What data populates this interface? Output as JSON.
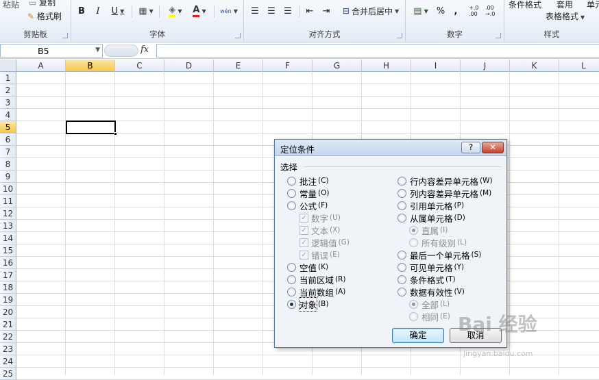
{
  "ribbon": {
    "clipboard": {
      "paste_label": "粘贴",
      "copy_label": "复制",
      "format_painter_label": "格式刷",
      "group_label": "剪贴板"
    },
    "font": {
      "bold": "B",
      "italic": "I",
      "underline": "U",
      "font_color": "A",
      "phonetic": "wén",
      "group_label": "字体"
    },
    "alignment": {
      "merge_center_label": "合并后居中",
      "group_label": "对齐方式"
    },
    "number": {
      "percent": "%",
      "comma": ",",
      "increase_decimal": "+.0 .00",
      "decrease_decimal": ".00 →.0",
      "group_label": "数字"
    },
    "styles": {
      "conditional_format_label": "条件格式",
      "table_format_label": "表格格式",
      "apply_label": "套用",
      "cell_label": "单元",
      "group_label": "样式"
    }
  },
  "formula_bar": {
    "name_box": "B5",
    "fx": "fx",
    "formula": ""
  },
  "sheet": {
    "columns": [
      "A",
      "B",
      "C",
      "D",
      "E",
      "F",
      "G",
      "H",
      "I",
      "J",
      "K",
      "L"
    ],
    "rows": [
      "1",
      "2",
      "3",
      "4",
      "5",
      "6",
      "7",
      "8",
      "9",
      "10",
      "11",
      "12",
      "13",
      "14",
      "15",
      "16",
      "17",
      "18",
      "19",
      "20",
      "21",
      "22",
      "23",
      "24",
      "25"
    ],
    "active_column": "B",
    "active_row": "5"
  },
  "dialog": {
    "title": "定位条件",
    "help": "?",
    "close": "✕",
    "section_label": "选择",
    "left_options": [
      {
        "label": "批注",
        "key": "C"
      },
      {
        "label": "常量",
        "key": "O"
      },
      {
        "label": "公式",
        "key": "F"
      },
      {
        "label": "数字",
        "key": "U"
      },
      {
        "label": "文本",
        "key": "X"
      },
      {
        "label": "逻辑值",
        "key": "G"
      },
      {
        "label": "错误",
        "key": "E"
      },
      {
        "label": "空值",
        "key": "K"
      },
      {
        "label": "当前区域",
        "key": "R"
      },
      {
        "label": "当前数组",
        "key": "A"
      },
      {
        "label": "对象",
        "key": "B"
      }
    ],
    "right_options": [
      {
        "label": "行内容差异单元格",
        "key": "W"
      },
      {
        "label": "列内容差异单元格",
        "key": "M"
      },
      {
        "label": "引用单元格",
        "key": "P"
      },
      {
        "label": "从属单元格",
        "key": "D"
      },
      {
        "label": "直属",
        "key": "I"
      },
      {
        "label": "所有级别",
        "key": "L"
      },
      {
        "label": "最后一个单元格",
        "key": "S"
      },
      {
        "label": "可见单元格",
        "key": "Y"
      },
      {
        "label": "条件格式",
        "key": "T"
      },
      {
        "label": "数据有效性",
        "key": "V"
      },
      {
        "label": "全部",
        "key": "L"
      },
      {
        "label": "相同",
        "key": "E"
      }
    ],
    "selected_option": "对象",
    "ok_label": "确定",
    "cancel_label": "取消"
  },
  "watermark": {
    "brand": "Bai 经验",
    "url": "jingyan.baidu.com"
  }
}
